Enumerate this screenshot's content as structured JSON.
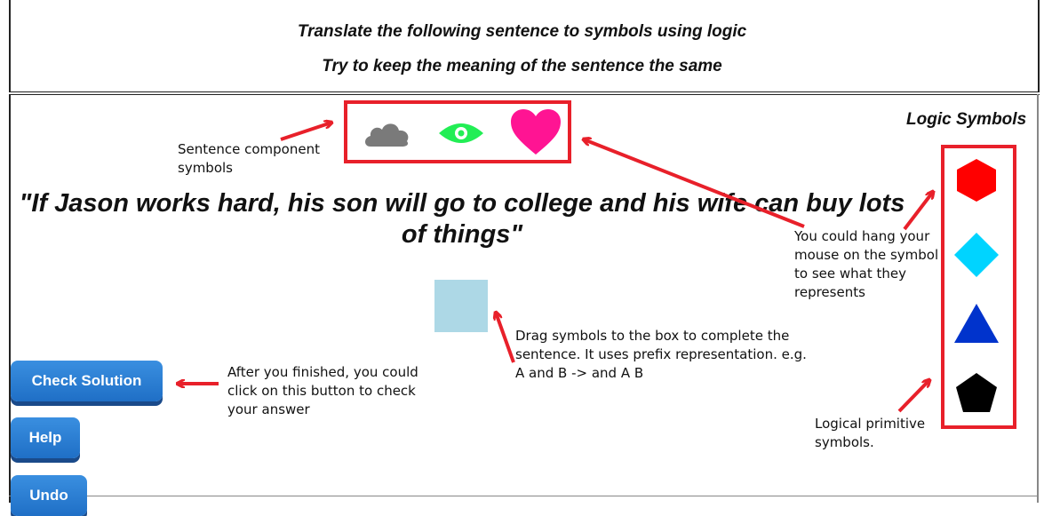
{
  "header": {
    "instruction_1": "Translate the following sentence to symbols using logic",
    "instruction_2": "Try to keep the meaning of the sentence the same"
  },
  "sentence": "\"If Jason works hard, his son will go to college and his wife can buy lots of things\"",
  "logic_symbols_title": "Logic Symbols",
  "component_symbols": [
    {
      "icon": "cloud-icon",
      "color": "#7a7a7a"
    },
    {
      "icon": "eye-icon",
      "color": "#22ee55"
    },
    {
      "icon": "heart-icon",
      "color": "#ff1493"
    }
  ],
  "logic_symbols": [
    {
      "icon": "hexagon-icon",
      "color": "#ff0000"
    },
    {
      "icon": "diamond-icon",
      "color": "#00d4ff"
    },
    {
      "icon": "triangle-icon",
      "color": "#0033cc"
    },
    {
      "icon": "pentagon-icon",
      "color": "#000000"
    }
  ],
  "drop_box_color": "#add8e6",
  "annotations": {
    "component": "Sentence component symbols",
    "hover": "You could hang your mouse on the symbol to see what they represents",
    "drag": "Drag symbols to the box to complete the sentence. It uses prefix representation. e.g. A and B -> and A B",
    "check": "After you finished, you could click on this button to check your answer",
    "primitive": "Logical primitive symbols."
  },
  "buttons": {
    "check": "Check Solution",
    "help": "Help",
    "undo": "Undo"
  },
  "accent_red": "#e8202a"
}
